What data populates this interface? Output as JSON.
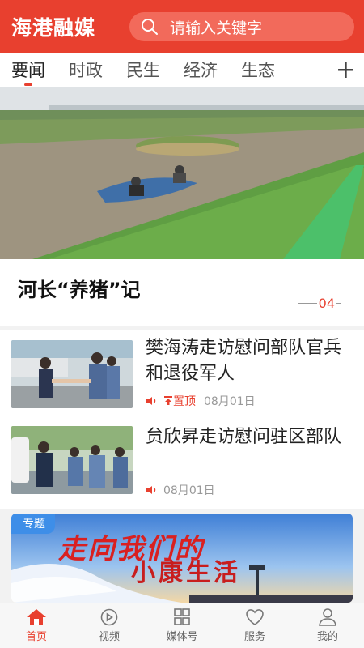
{
  "header": {
    "app_title": "海港融媒",
    "search_placeholder": "请输入关键字"
  },
  "tabs": [
    {
      "label": "要闻",
      "active": true
    },
    {
      "label": "时政"
    },
    {
      "label": "民生"
    },
    {
      "label": "经济"
    },
    {
      "label": "生态"
    }
  ],
  "tab_add_icon": "plus-icon",
  "hero": {
    "title": "河长“养猪”记",
    "page": "04"
  },
  "news": [
    {
      "title": "樊海涛走访慰问部队官兵和退役军人",
      "pinned": true,
      "pin_label": "置顶",
      "date": "08月01日"
    },
    {
      "title": "贠欣昇走访慰问驻区部队",
      "pinned": false,
      "date": "08月01日"
    }
  ],
  "topic": {
    "badge": "专题",
    "line1": "走向我们的",
    "line2": "小康生活"
  },
  "bottom_nav": [
    {
      "label": "首页",
      "icon": "home-icon",
      "active": true
    },
    {
      "label": "视频",
      "icon": "video-icon"
    },
    {
      "label": "媒体号",
      "icon": "grid-icon"
    },
    {
      "label": "服务",
      "icon": "heart-icon"
    },
    {
      "label": "我的",
      "icon": "user-icon"
    }
  ],
  "colors": {
    "brand": "#e8402f",
    "topic_blue": "#3e8ee8"
  }
}
